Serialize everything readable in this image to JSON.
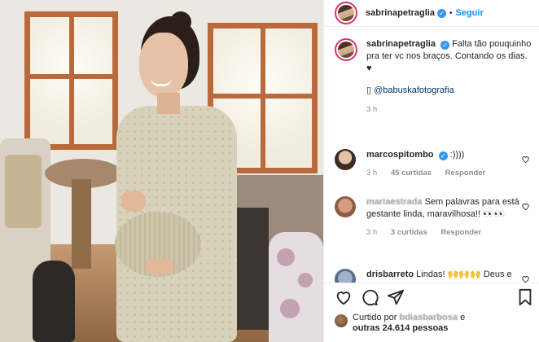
{
  "post": {
    "author": "sabrinapetraglia",
    "follow_label": "Seguir",
    "dot": "•"
  },
  "caption": {
    "author": "sabrinapetraglia",
    "text": "Falta tão pouquinho pra ter vc nos braços. Contando os dias. ♥",
    "credit_icon": "▯",
    "credit_tag": "@babuskafotografia",
    "time": "3 h"
  },
  "comments": [
    {
      "user": "marcospitombo",
      "verified": true,
      "text": ":))))",
      "time": "3 h",
      "likes": "45 curtidas",
      "reply": "Responder"
    },
    {
      "user": "mariaestrada",
      "text": "Sem palavras para está gestante linda, maravilhosa!! 👀👀",
      "time": "3 h",
      "likes": "3 curtidas",
      "reply": "Responder"
    },
    {
      "user": "drisbarreto",
      "text": "Lindas! 🙌🙌🙌 Deus e"
    }
  ],
  "likes": {
    "prefix": "Curtido por",
    "user": "bdiasbarbosa",
    "joiner": "e",
    "others": "outras 24.614 pessoas"
  },
  "icons": {
    "verified": "verified-badge-icon",
    "heart": "heart-icon",
    "comment": "comment-icon",
    "share": "share-icon",
    "save": "bookmark-icon"
  },
  "colors": {
    "accent": "#0095f6",
    "verified": "#3897f0",
    "story_ring": "#e1306c",
    "muted": "#8e8e8e"
  }
}
